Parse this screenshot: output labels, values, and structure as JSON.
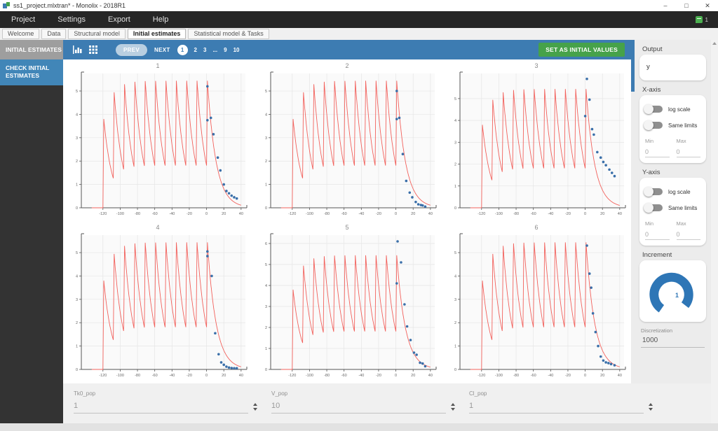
{
  "window": {
    "title": "ss1_project.mlxtran* - Monolix - 2018R1",
    "minimize": "–",
    "maximize": "□",
    "close": "✕"
  },
  "menubar": {
    "items": [
      "Project",
      "Settings",
      "Export",
      "Help"
    ],
    "notification_count": "1"
  },
  "tabbar": {
    "tabs": [
      "Welcome",
      "Data",
      "Structural model",
      "Initial estimates",
      "Statistical model & Tasks"
    ],
    "active": "Initial estimates"
  },
  "sidebar": {
    "header": "INITIAL ESTIMATES",
    "item_check": "CHECK INITIAL ESTIMATES"
  },
  "toolbar": {
    "prev_label": "PREV",
    "next_label": "NEXT",
    "pages": [
      "1",
      "2",
      "3",
      "...",
      "9",
      "10"
    ],
    "active_page": "1",
    "set_button": "SET AS INITIAL VALUES"
  },
  "rightpanel": {
    "output": {
      "label": "Output",
      "value": "y"
    },
    "x_axis": {
      "label": "X-axis",
      "log_scale_label": "log scale",
      "same_limits_label": "Same limits",
      "log_scale_on": false,
      "same_limits_on": false,
      "min_label": "Min",
      "max_label": "Max",
      "min_value": "0",
      "max_value": "0"
    },
    "y_axis": {
      "label": "Y-axis",
      "log_scale_label": "log scale",
      "same_limits_label": "Same limits",
      "log_scale_on": false,
      "same_limits_on": false,
      "min_label": "Min",
      "max_label": "Max",
      "min_value": "0",
      "max_value": "0"
    },
    "increment": {
      "label": "Increment",
      "value": "1",
      "accent_color": "#2e76b6"
    },
    "discretization": {
      "label": "Discretization",
      "value": "1000"
    }
  },
  "parambar": {
    "fields": [
      {
        "label": "Tk0_pop",
        "value": "1"
      },
      {
        "label": "V_pop",
        "value": "10"
      },
      {
        "label": "Cl_pop",
        "value": "1"
      }
    ]
  },
  "chart_data": {
    "type": "line",
    "description": "Predicted concentration (red line, identical population prediction per subject) vs observed data (blue dots) for subjects 1-6; repeated doses every 12 h from t=-120 to t=0 then washout",
    "xlim": [
      -145,
      45
    ],
    "xticks": [
      -120,
      -100,
      -80,
      -60,
      -40,
      -20,
      0,
      20,
      40
    ],
    "curve_color": "#f2615c",
    "dots_color": "#3a6fa9",
    "grid": true,
    "prediction_curve": {
      "first_dose": -120,
      "dose_interval": 12,
      "n_doses": 11,
      "infusion_duration": 1,
      "elimination_rate": 0.1,
      "single_dose_peak": 3.8,
      "steady_state_peak": 5.44,
      "steady_state_trough": 1.82
    },
    "subplots": [
      {
        "title": "1",
        "ymax": 5.75,
        "yticks": [
          0,
          1,
          2,
          3,
          4,
          5
        ],
        "dots": [
          [
            1,
            5.2
          ],
          [
            1,
            3.75
          ],
          [
            5,
            3.85
          ],
          [
            8,
            3.15
          ],
          [
            13,
            2.15
          ],
          [
            16,
            1.6
          ],
          [
            20,
            1.0
          ],
          [
            23,
            0.72
          ],
          [
            26,
            0.62
          ],
          [
            29,
            0.52
          ],
          [
            32,
            0.45
          ],
          [
            35,
            0.4
          ]
        ]
      },
      {
        "title": "2",
        "ymax": 5.75,
        "yticks": [
          0,
          1,
          2,
          3,
          4,
          5
        ],
        "dots": [
          [
            1,
            5.0
          ],
          [
            1,
            3.8
          ],
          [
            4,
            3.85
          ],
          [
            8,
            2.3
          ],
          [
            12,
            1.15
          ],
          [
            16,
            0.65
          ],
          [
            19,
            0.45
          ],
          [
            23,
            0.25
          ],
          [
            26,
            0.15
          ],
          [
            29,
            0.12
          ],
          [
            31,
            0.1
          ],
          [
            34,
            0.05
          ]
        ]
      },
      {
        "title": "3",
        "ymax": 6.15,
        "yticks": [
          0,
          1,
          2,
          3,
          4,
          5
        ],
        "dots": [
          [
            0,
            4.2
          ],
          [
            2,
            5.9
          ],
          [
            5,
            4.95
          ],
          [
            8,
            3.6
          ],
          [
            10,
            3.35
          ],
          [
            14,
            2.55
          ],
          [
            18,
            2.3
          ],
          [
            21,
            2.1
          ],
          [
            24,
            1.95
          ],
          [
            28,
            1.75
          ],
          [
            31,
            1.6
          ],
          [
            34,
            1.45
          ]
        ]
      },
      {
        "title": "4",
        "ymax": 5.75,
        "yticks": [
          0,
          1,
          2,
          3,
          4,
          5
        ],
        "dots": [
          [
            1,
            5.05
          ],
          [
            1,
            4.85
          ],
          [
            6,
            4.0
          ],
          [
            10,
            1.55
          ],
          [
            14,
            0.65
          ],
          [
            17,
            0.3
          ],
          [
            20,
            0.2
          ],
          [
            23,
            0.12
          ],
          [
            26,
            0.08
          ],
          [
            29,
            0.06
          ],
          [
            32,
            0.05
          ],
          [
            35,
            0.05
          ]
        ]
      },
      {
        "title": "5",
        "ymax": 6.4,
        "yticks": [
          0,
          1,
          2,
          3,
          4,
          5,
          6
        ],
        "dots": [
          [
            1,
            4.1
          ],
          [
            2,
            6.1
          ],
          [
            6,
            5.1
          ],
          [
            10,
            3.1
          ],
          [
            13,
            2.05
          ],
          [
            17,
            1.4
          ],
          [
            21,
            0.8
          ],
          [
            24,
            0.7
          ],
          [
            28,
            0.32
          ],
          [
            31,
            0.28
          ],
          [
            34,
            0.15
          ]
        ]
      },
      {
        "title": "6",
        "ymax": 5.75,
        "yticks": [
          0,
          1,
          2,
          3,
          4,
          5
        ],
        "dots": [
          [
            2,
            5.3
          ],
          [
            5,
            4.1
          ],
          [
            7,
            3.5
          ],
          [
            9,
            2.4
          ],
          [
            12,
            1.6
          ],
          [
            15,
            1.0
          ],
          [
            18,
            0.55
          ],
          [
            21,
            0.38
          ],
          [
            24,
            0.3
          ],
          [
            27,
            0.27
          ],
          [
            30,
            0.23
          ],
          [
            34,
            0.18
          ]
        ]
      }
    ]
  }
}
